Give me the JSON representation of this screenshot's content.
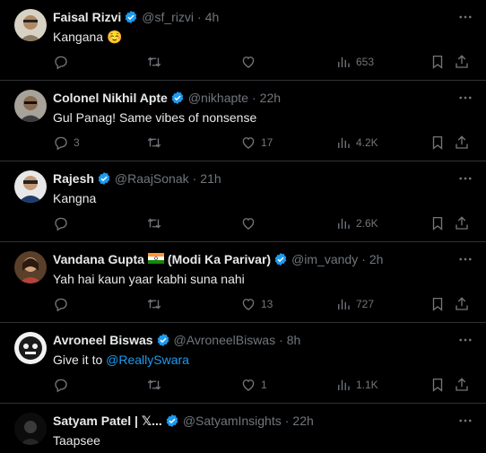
{
  "tweets": [
    {
      "name": "Faisal Rizvi",
      "verified": true,
      "handle": "@sf_rizvi",
      "time": "4h",
      "text": "Kangana ☺️",
      "replies": "",
      "retweets": "",
      "likes": "",
      "views": "653",
      "avatar_color": "#c9b89a"
    },
    {
      "name": "Colonel Nikhil Apte",
      "verified": true,
      "handle": "@nikhapte",
      "time": "22h",
      "text": "Gul Panag! Same vibes of nonsense",
      "replies": "3",
      "retweets": "",
      "likes": "17",
      "views": "4.2K",
      "avatar_color": "#6b6b6b"
    },
    {
      "name": "Rajesh",
      "verified": true,
      "handle": "@RaajSonak",
      "time": "21h",
      "text": "Kangna",
      "replies": "",
      "retweets": "",
      "likes": "",
      "views": "2.6K",
      "avatar_color": "#2b4a78"
    },
    {
      "name": "Vandana Gupta",
      "flag": true,
      "name_suffix": "(Modi Ka Parivar)",
      "verified": true,
      "handle": "@im_vandy",
      "time": "2h",
      "text": "Yah hai kaun yaar kabhi suna nahi",
      "replies": "",
      "retweets": "",
      "likes": "13",
      "views": "727",
      "avatar_color": "#7a5a3a"
    },
    {
      "name": "Avroneel Biswas",
      "verified": true,
      "handle": "@AvroneelBiswas",
      "time": "8h",
      "text_prefix": "Give it to ",
      "mention": "@ReallySwara",
      "replies": "",
      "retweets": "",
      "likes": "1",
      "views": "1.1K",
      "avatar_color": "#dcdcdc"
    },
    {
      "name": "Satyam Patel | 𝕏...",
      "verified": true,
      "handle": "@SatyamInsights",
      "time": "22h",
      "text": "Taapsee",
      "avatar_color": "#111111"
    }
  ],
  "separator": "·",
  "colors": {
    "background": "#000000",
    "text": "#e7e9ea",
    "muted": "#71767b",
    "verified": "#1d9bf0",
    "border": "#2f3336"
  }
}
